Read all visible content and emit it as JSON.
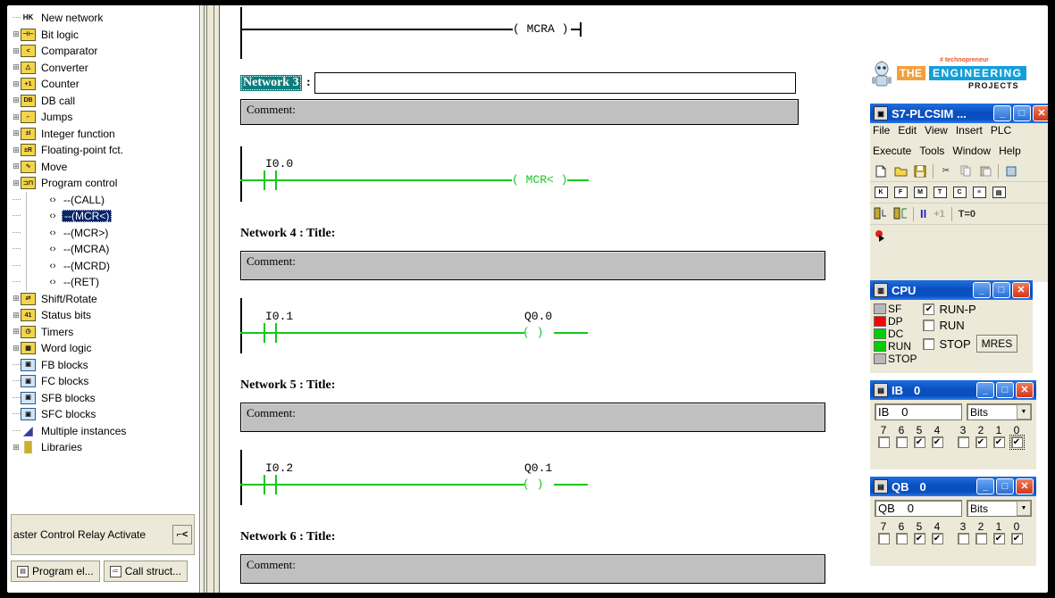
{
  "tree": {
    "items": [
      {
        "label": "New network",
        "icon": "new-network-icon",
        "level": 1,
        "expandable": false,
        "selected": false
      },
      {
        "label": "Bit logic",
        "icon": "folder-bit-logic-icon",
        "level": 1,
        "expandable": true,
        "selected": false
      },
      {
        "label": "Comparator",
        "icon": "folder-comparator-icon",
        "level": 1,
        "expandable": true,
        "selected": false
      },
      {
        "label": "Converter",
        "icon": "folder-converter-icon",
        "level": 1,
        "expandable": true,
        "selected": false
      },
      {
        "label": "Counter",
        "icon": "folder-counter-icon",
        "level": 1,
        "expandable": true,
        "selected": false
      },
      {
        "label": "DB call",
        "icon": "folder-db-call-icon",
        "level": 1,
        "expandable": true,
        "selected": false
      },
      {
        "label": "Jumps",
        "icon": "folder-jumps-icon",
        "level": 1,
        "expandable": true,
        "selected": false
      },
      {
        "label": "Integer function",
        "icon": "folder-integer-function-icon",
        "level": 1,
        "expandable": true,
        "selected": false
      },
      {
        "label": "Floating-point fct.",
        "icon": "folder-floating-point-icon",
        "level": 1,
        "expandable": true,
        "selected": false
      },
      {
        "label": "Move",
        "icon": "folder-move-icon",
        "level": 1,
        "expandable": true,
        "selected": false
      },
      {
        "label": "Program control",
        "icon": "folder-program-control-icon",
        "level": 1,
        "expandable": true,
        "selected": false
      },
      {
        "label": "--(CALL)",
        "icon": "coil-element-icon",
        "level": 2,
        "expandable": false,
        "selected": false
      },
      {
        "label": "--(MCR<)",
        "icon": "coil-element-icon",
        "level": 2,
        "expandable": false,
        "selected": true
      },
      {
        "label": "--(MCR>)",
        "icon": "coil-element-icon",
        "level": 2,
        "expandable": false,
        "selected": false
      },
      {
        "label": "--(MCRA)",
        "icon": "coil-element-icon",
        "level": 2,
        "expandable": false,
        "selected": false
      },
      {
        "label": "--(MCRD)",
        "icon": "coil-element-icon",
        "level": 2,
        "expandable": false,
        "selected": false
      },
      {
        "label": "--(RET)",
        "icon": "coil-element-icon",
        "level": 2,
        "expandable": false,
        "selected": false
      },
      {
        "label": "Shift/Rotate",
        "icon": "folder-shift-rotate-icon",
        "level": 1,
        "expandable": true,
        "selected": false
      },
      {
        "label": "Status bits",
        "icon": "folder-status-bits-icon",
        "level": 1,
        "expandable": true,
        "selected": false
      },
      {
        "label": "Timers",
        "icon": "folder-timers-icon",
        "level": 1,
        "expandable": true,
        "selected": false
      },
      {
        "label": "Word logic",
        "icon": "folder-word-logic-icon",
        "level": 1,
        "expandable": true,
        "selected": false
      },
      {
        "label": "FB blocks",
        "icon": "fb-blocks-icon",
        "level": 1,
        "expandable": false,
        "selected": false
      },
      {
        "label": "FC blocks",
        "icon": "fc-blocks-icon",
        "level": 1,
        "expandable": false,
        "selected": false
      },
      {
        "label": "SFB blocks",
        "icon": "sfb-blocks-icon",
        "level": 1,
        "expandable": false,
        "selected": false
      },
      {
        "label": "SFC blocks",
        "icon": "sfc-blocks-icon",
        "level": 1,
        "expandable": false,
        "selected": false
      },
      {
        "label": "Multiple instances",
        "icon": "multiple-instances-icon",
        "level": 1,
        "expandable": false,
        "selected": false
      },
      {
        "label": "Libraries",
        "icon": "libraries-icon",
        "level": 1,
        "expandable": true,
        "selected": false
      }
    ],
    "status_hint": "aster Control Relay Activate",
    "status_hint_button": "⌐<",
    "tabs": [
      {
        "label": "Program el...",
        "icon": "program-elements-icon",
        "active": true
      },
      {
        "label": "Call struct...",
        "icon": "call-structure-icon",
        "active": false
      }
    ]
  },
  "ladder": {
    "network2": {
      "coil": "( MCRA )",
      "energized": false
    },
    "network3": {
      "selected_label": "Network 3",
      "colon": ":",
      "title_value": "",
      "comment": "Comment:",
      "contact_address": "I0.0",
      "coil": "( MCR< )",
      "energized": true
    },
    "network4": {
      "header": "Network 4 : Title:",
      "comment": "Comment:",
      "contact_address": "I0.1",
      "coil_address": "Q0.0",
      "coil": "( )",
      "energized": true
    },
    "network5": {
      "header": "Network 5 : Title:",
      "comment": "Comment:",
      "contact_address": "I0.2",
      "coil_address": "Q0.1",
      "coil": "( )",
      "energized": true
    },
    "network6": {
      "header": "Network 6 : Title:",
      "comment": "Comment:"
    }
  },
  "logo": {
    "tagline": "# technopreneur",
    "word1": "THE",
    "word2": "ENGINEERING",
    "word3": "PROJECTS"
  },
  "plcsim": {
    "title": "S7-PLCSIM ...",
    "title_icon": "plcsim-app-icon",
    "minimize": "_",
    "maximize": "□",
    "close": "✕",
    "menus": [
      "File",
      "Edit",
      "View",
      "Insert",
      "PLC",
      "Execute",
      "Tools",
      "Window",
      "Help"
    ],
    "toolbar1": [
      {
        "name": "new-file-icon",
        "glyph": "🗋"
      },
      {
        "name": "open-file-icon",
        "glyph": "📂"
      },
      {
        "name": "save-file-icon",
        "glyph": "💾"
      },
      {
        "name": "cut-icon",
        "glyph": "✂"
      },
      {
        "name": "copy-icon",
        "glyph": "⧉"
      },
      {
        "name": "paste-icon",
        "glyph": "📋"
      }
    ],
    "toolbar2": [
      {
        "name": "insert-input-variable-icon",
        "glyph": "K"
      },
      {
        "name": "insert-output-variable-icon",
        "glyph": "F"
      },
      {
        "name": "insert-memory-variable-icon",
        "glyph": "M"
      },
      {
        "name": "insert-timer-variable-icon",
        "glyph": "T"
      },
      {
        "name": "insert-counter-variable-icon",
        "glyph": "C"
      },
      {
        "name": "insert-generic-variable-icon",
        "glyph": "≡"
      },
      {
        "name": "insert-vertical-bits-icon",
        "glyph": "▤"
      }
    ],
    "toolbar3": {
      "scan_single_icon": "scan-cycle-single-icon",
      "scan_continuous_icon": "scan-cycle-continuous-icon",
      "pause_label": "II",
      "next_cycle_label": "+1",
      "reset_timer_label": "T=0"
    },
    "toolbar4": {
      "record_icon": "record-playback-icon"
    },
    "cpu": {
      "title": "CPU",
      "title_icon": "cpu-window-icon",
      "minimize": "_",
      "maximize": "□",
      "close": "✕",
      "leds": [
        {
          "label": "SF",
          "color": "#b8b8b8"
        },
        {
          "label": "DP",
          "color": "#ff0000"
        },
        {
          "label": "DC",
          "color": "#00d000"
        },
        {
          "label": "RUN",
          "color": "#00d000"
        },
        {
          "label": "STOP",
          "color": "#b8b8b8"
        }
      ],
      "modes": [
        {
          "label": "RUN-P",
          "checked": true
        },
        {
          "label": "RUN",
          "checked": false
        },
        {
          "label": "STOP",
          "checked": false
        }
      ],
      "mres_label": "MRES"
    },
    "ib_window": {
      "title_prefix": "IB",
      "title_value": "0",
      "title_icon": "variable-window-icon",
      "minimize": "_",
      "maximize": "□",
      "close": "✕",
      "name": "IB",
      "address": "0",
      "format": "Bits",
      "bit_labels": [
        "7",
        "6",
        "5",
        "4",
        "3",
        "2",
        "1",
        "0"
      ],
      "bits": [
        false,
        false,
        true,
        true,
        false,
        true,
        true,
        true
      ],
      "focused_bit": 0
    },
    "qb_window": {
      "title_prefix": "QB",
      "title_value": "0",
      "title_icon": "variable-window-icon",
      "minimize": "_",
      "maximize": "□",
      "close": "✕",
      "name": "QB",
      "address": "0",
      "format": "Bits",
      "bit_labels": [
        "7",
        "6",
        "5",
        "4",
        "3",
        "2",
        "1",
        "0"
      ],
      "bits": [
        false,
        false,
        true,
        true,
        false,
        false,
        true,
        true
      ]
    }
  }
}
